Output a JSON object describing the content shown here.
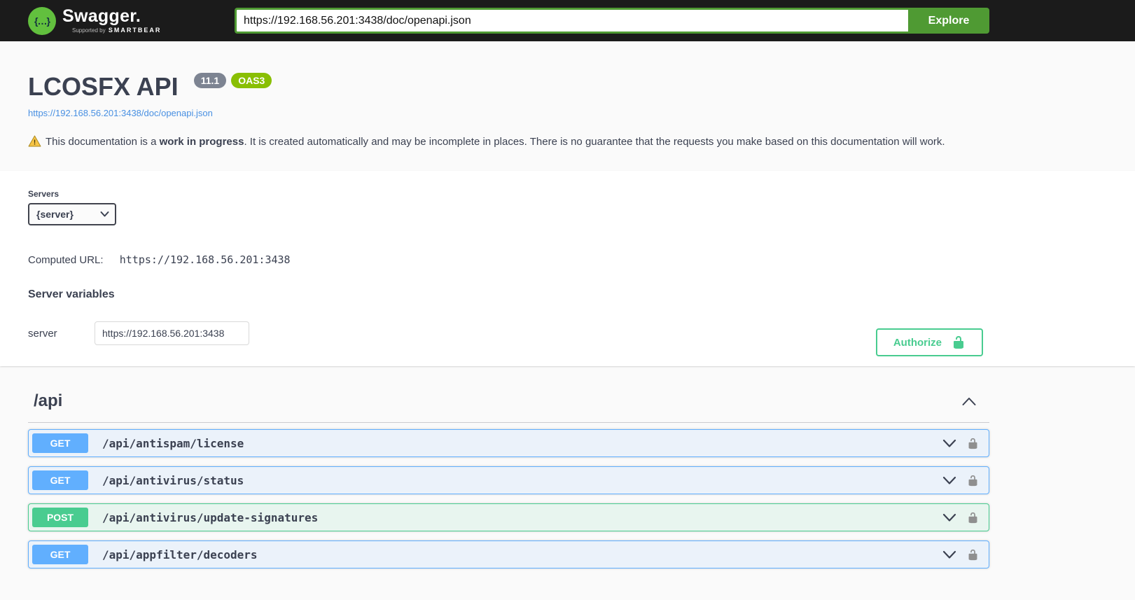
{
  "topbar": {
    "logo_glyph": "{…}",
    "logo_text": "Swagger.",
    "logo_sub_prefix": "Supported by",
    "logo_sub_brand": "SMARTBEAR",
    "url_value": "https://192.168.56.201:3438/doc/openapi.json",
    "explore_label": "Explore"
  },
  "info": {
    "title": "LCOSFX API",
    "version_badge": "11.1",
    "oas_badge": "OAS3",
    "spec_link": "https://192.168.56.201:3438/doc/openapi.json",
    "warning_prefix": "This documentation is a ",
    "warning_bold": "work in progress",
    "warning_suffix": ". It is created automatically and may be incomplete in places. There is no guarantee that the requests you make based on this documentation will work."
  },
  "servers": {
    "label": "Servers",
    "selected_option": "{server}",
    "computed_url_label": "Computed URL:",
    "computed_url_value": "https://192.168.56.201:3438",
    "variables_title": "Server variables",
    "variable_name": "server",
    "variable_value": "https://192.168.56.201:3438"
  },
  "auth": {
    "authorize_label": "Authorize"
  },
  "api_section": {
    "title": "/api",
    "operations": [
      {
        "method": "GET",
        "path": "/api/antispam/license"
      },
      {
        "method": "GET",
        "path": "/api/antivirus/status"
      },
      {
        "method": "POST",
        "path": "/api/antivirus/update-signatures"
      },
      {
        "method": "GET",
        "path": "/api/appfilter/decoders"
      }
    ]
  },
  "colors": {
    "get_blue": "#61affe",
    "post_green": "#49cc90",
    "explore_green": "#4f9a33",
    "authorize_green": "#49cc90",
    "oas_badge_green": "#89bf04",
    "version_badge_gray": "#7d8492",
    "link_blue": "#4990e2",
    "topbar_dark": "#1b1b1b"
  }
}
